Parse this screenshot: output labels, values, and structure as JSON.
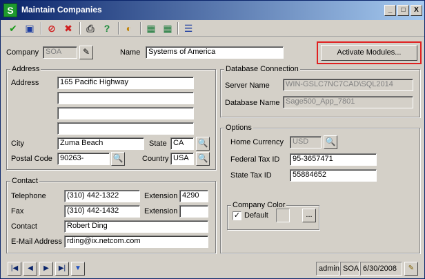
{
  "window": {
    "title": "Maintain Companies",
    "app_icon": "S"
  },
  "titlebar": {
    "minimize": "_",
    "maximize": "□",
    "close": "X"
  },
  "toolbar": {
    "icons": [
      "check-icon",
      "save-icon",
      "cancel-icon",
      "delete-icon",
      "print-icon",
      "help-icon",
      "color-wheel-icon",
      "spreadsheet-export-icon",
      "spreadsheet-import-icon",
      "properties-icon"
    ]
  },
  "header": {
    "company_label": "Company",
    "company_value": "SOA",
    "name_label": "Name",
    "name_value": "Systems of America",
    "activate_button": "Activate Modules..."
  },
  "address": {
    "title": "Address",
    "address_label": "Address",
    "line1": "165 Pacific Highway",
    "line2": "",
    "line3": "",
    "line4": "",
    "city_label": "City",
    "city_value": "Zuma Beach",
    "state_label": "State",
    "state_value": "CA",
    "postal_label": "Postal Code",
    "postal_value": "90263-",
    "country_label": "Country",
    "country_value": "USA"
  },
  "contact": {
    "title": "Contact",
    "telephone_label": "Telephone",
    "telephone_value": "(310) 442-1322",
    "extension_label": "Extension",
    "extension_value": "4290",
    "fax_label": "Fax",
    "fax_value": "(310) 442-1432",
    "fax_extension_label": "Extension",
    "fax_extension_value": "",
    "contact_label": "Contact",
    "contact_value": "Robert Ding",
    "email_label": "E-Mail Address",
    "email_value": "rding@ix.netcom.com"
  },
  "database": {
    "title": "Database Connection",
    "server_label": "Server Name",
    "server_value": "WIN-GSLC7NC7CAD\\SQL2014",
    "db_label": "Database Name",
    "db_value": "Sage500_App_7801"
  },
  "options": {
    "title": "Options",
    "currency_label": "Home Currency",
    "currency_value": "USD",
    "federal_label": "Federal Tax ID",
    "federal_value": "95-3657471",
    "state_tax_label": "State Tax ID",
    "state_tax_value": "55884652",
    "color_title": "Company Color",
    "default_label": "Default",
    "default_checked": "✓",
    "ellipsis": "..."
  },
  "status": {
    "user": "admin",
    "company": "SOA",
    "date": "6/30/2008"
  },
  "nav": {
    "first": "|◀",
    "prev": "◀",
    "next": "▶",
    "last": "▶|"
  }
}
